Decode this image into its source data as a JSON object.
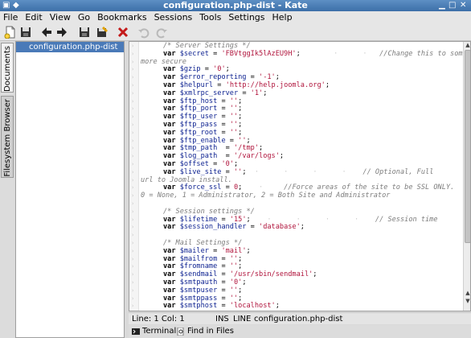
{
  "window": {
    "title": "configuration.php-dist - Kate"
  },
  "menu": [
    "File",
    "Edit",
    "View",
    "Go",
    "Bookmarks",
    "Sessions",
    "Tools",
    "Settings",
    "Help"
  ],
  "toolbar": {
    "icons": [
      "new-document-icon",
      "save-icon",
      "back-arrow-icon",
      "forward-arrow-icon",
      "save-as-icon",
      "save-all-icon",
      "close-icon",
      "undo-icon",
      "redo-icon"
    ]
  },
  "sidebar": {
    "tabs": [
      "Documents",
      "Filesystem Browser"
    ],
    "documents": [
      "configuration.php-dist"
    ]
  },
  "editor": {
    "lines": [
      [
        {
          "c": "cm",
          "t": "/* Server Settings */"
        }
      ],
      [
        {
          "c": "kw",
          "t": "var "
        },
        {
          "c": "var",
          "t": "$secret"
        },
        {
          "c": "",
          "t": " = "
        },
        {
          "c": "str",
          "t": "'FBVtggIk5lAzEU9H'"
        },
        {
          "c": "",
          "t": ";"
        },
        {
          "c": "dots",
          "t": "        ·      ·   "
        },
        {
          "c": "cm",
          "t": "//Change this to something"
        }
      ],
      [
        {
          "c": "cm",
          "t": "more secure"
        }
      ],
      [
        {
          "c": "kw",
          "t": "var "
        },
        {
          "c": "var",
          "t": "$gzip"
        },
        {
          "c": "",
          "t": " = "
        },
        {
          "c": "str",
          "t": "'0'"
        },
        {
          "c": "",
          "t": ";"
        }
      ],
      [
        {
          "c": "kw",
          "t": "var "
        },
        {
          "c": "var",
          "t": "$error_reporting"
        },
        {
          "c": "",
          "t": " = "
        },
        {
          "c": "str",
          "t": "'-1'"
        },
        {
          "c": "",
          "t": ";"
        }
      ],
      [
        {
          "c": "kw",
          "t": "var "
        },
        {
          "c": "var",
          "t": "$helpurl"
        },
        {
          "c": "",
          "t": " = "
        },
        {
          "c": "str",
          "t": "'http://help.joomla.org'"
        },
        {
          "c": "",
          "t": ";"
        }
      ],
      [
        {
          "c": "kw",
          "t": "var "
        },
        {
          "c": "var",
          "t": "$xmlrpc_server"
        },
        {
          "c": "",
          "t": " = "
        },
        {
          "c": "str",
          "t": "'1'"
        },
        {
          "c": "",
          "t": ";"
        }
      ],
      [
        {
          "c": "kw",
          "t": "var "
        },
        {
          "c": "var",
          "t": "$ftp_host"
        },
        {
          "c": "",
          "t": " = "
        },
        {
          "c": "str",
          "t": "''"
        },
        {
          "c": "",
          "t": ";"
        }
      ],
      [
        {
          "c": "kw",
          "t": "var "
        },
        {
          "c": "var",
          "t": "$ftp_port"
        },
        {
          "c": "",
          "t": " = "
        },
        {
          "c": "str",
          "t": "''"
        },
        {
          "c": "",
          "t": ";"
        }
      ],
      [
        {
          "c": "kw",
          "t": "var "
        },
        {
          "c": "var",
          "t": "$ftp_user"
        },
        {
          "c": "",
          "t": " = "
        },
        {
          "c": "str",
          "t": "''"
        },
        {
          "c": "",
          "t": ";"
        }
      ],
      [
        {
          "c": "kw",
          "t": "var "
        },
        {
          "c": "var",
          "t": "$ftp_pass"
        },
        {
          "c": "",
          "t": " = "
        },
        {
          "c": "str",
          "t": "''"
        },
        {
          "c": "",
          "t": ";"
        }
      ],
      [
        {
          "c": "kw",
          "t": "var "
        },
        {
          "c": "var",
          "t": "$ftp_root"
        },
        {
          "c": "",
          "t": " = "
        },
        {
          "c": "str",
          "t": "''"
        },
        {
          "c": "",
          "t": ";"
        }
      ],
      [
        {
          "c": "kw",
          "t": "var "
        },
        {
          "c": "var",
          "t": "$ftp_enable"
        },
        {
          "c": "",
          "t": " = "
        },
        {
          "c": "str",
          "t": "''"
        },
        {
          "c": "",
          "t": ";"
        }
      ],
      [
        {
          "c": "kw",
          "t": "var "
        },
        {
          "c": "var",
          "t": "$tmp_path"
        },
        {
          "c": "",
          "t": "  = "
        },
        {
          "c": "str",
          "t": "'/tmp'"
        },
        {
          "c": "",
          "t": ";"
        }
      ],
      [
        {
          "c": "kw",
          "t": "var "
        },
        {
          "c": "var",
          "t": "$log_path"
        },
        {
          "c": "",
          "t": "  = "
        },
        {
          "c": "str",
          "t": "'/var/logs'"
        },
        {
          "c": "",
          "t": ";"
        }
      ],
      [
        {
          "c": "kw",
          "t": "var "
        },
        {
          "c": "var",
          "t": "$offset"
        },
        {
          "c": "",
          "t": " = "
        },
        {
          "c": "str",
          "t": "'0'"
        },
        {
          "c": "",
          "t": ";"
        }
      ],
      [
        {
          "c": "kw",
          "t": "var "
        },
        {
          "c": "var",
          "t": "$live_site"
        },
        {
          "c": "",
          "t": " = "
        },
        {
          "c": "str",
          "t": "''"
        },
        {
          "c": "",
          "t": ";"
        },
        {
          "c": "dots",
          "t": "  ·      ·      ·      ·    "
        },
        {
          "c": "cm",
          "t": "// Optional, Full"
        }
      ],
      [
        {
          "c": "cm",
          "t": "url to Joomla install."
        }
      ],
      [
        {
          "c": "kw",
          "t": "var "
        },
        {
          "c": "var",
          "t": "$force_ssl"
        },
        {
          "c": "",
          "t": " = "
        },
        {
          "c": "num",
          "t": "0"
        },
        {
          "c": "",
          "t": ";"
        },
        {
          "c": "dots",
          "t": "    ·     "
        },
        {
          "c": "cm",
          "t": "//Force areas of the site to be SSL ONLY."
        }
      ],
      [
        {
          "c": "cm",
          "t": "0 = None, 1 = Administrator, 2 = Both Site and Administrator"
        }
      ],
      [
        {
          "c": "",
          "t": ""
        }
      ],
      [
        {
          "c": "cm",
          "t": "/* Session settings */"
        }
      ],
      [
        {
          "c": "kw",
          "t": "var "
        },
        {
          "c": "var",
          "t": "$lifetime"
        },
        {
          "c": "",
          "t": " = "
        },
        {
          "c": "str",
          "t": "'15'"
        },
        {
          "c": "",
          "t": ";"
        },
        {
          "c": "dots",
          "t": "    ·      ·      ·      ·    "
        },
        {
          "c": "cm",
          "t": "// Session time"
        }
      ],
      [
        {
          "c": "kw",
          "t": "var "
        },
        {
          "c": "var",
          "t": "$session_handler"
        },
        {
          "c": "",
          "t": " = "
        },
        {
          "c": "str",
          "t": "'database'"
        },
        {
          "c": "",
          "t": ";"
        }
      ],
      [
        {
          "c": "",
          "t": ""
        }
      ],
      [
        {
          "c": "cm",
          "t": "/* Mail Settings */"
        }
      ],
      [
        {
          "c": "kw",
          "t": "var "
        },
        {
          "c": "var",
          "t": "$mailer"
        },
        {
          "c": "",
          "t": " = "
        },
        {
          "c": "str",
          "t": "'mail'"
        },
        {
          "c": "",
          "t": ";"
        }
      ],
      [
        {
          "c": "kw",
          "t": "var "
        },
        {
          "c": "var",
          "t": "$mailfrom"
        },
        {
          "c": "",
          "t": " = "
        },
        {
          "c": "str",
          "t": "''"
        },
        {
          "c": "",
          "t": ";"
        }
      ],
      [
        {
          "c": "kw",
          "t": "var "
        },
        {
          "c": "var",
          "t": "$fromname"
        },
        {
          "c": "",
          "t": " = "
        },
        {
          "c": "str",
          "t": "''"
        },
        {
          "c": "",
          "t": ";"
        }
      ],
      [
        {
          "c": "kw",
          "t": "var "
        },
        {
          "c": "var",
          "t": "$sendmail"
        },
        {
          "c": "",
          "t": " = "
        },
        {
          "c": "str",
          "t": "'/usr/sbin/sendmail'"
        },
        {
          "c": "",
          "t": ";"
        }
      ],
      [
        {
          "c": "kw",
          "t": "var "
        },
        {
          "c": "var",
          "t": "$smtpauth"
        },
        {
          "c": "",
          "t": " = "
        },
        {
          "c": "str",
          "t": "'0'"
        },
        {
          "c": "",
          "t": ";"
        }
      ],
      [
        {
          "c": "kw",
          "t": "var "
        },
        {
          "c": "var",
          "t": "$smtpuser"
        },
        {
          "c": "",
          "t": " = "
        },
        {
          "c": "str",
          "t": "''"
        },
        {
          "c": "",
          "t": ";"
        }
      ],
      [
        {
          "c": "kw",
          "t": "var "
        },
        {
          "c": "var",
          "t": "$smtppass"
        },
        {
          "c": "",
          "t": " = "
        },
        {
          "c": "str",
          "t": "''"
        },
        {
          "c": "",
          "t": ";"
        }
      ],
      [
        {
          "c": "kw",
          "t": "var "
        },
        {
          "c": "var",
          "t": "$smtphost"
        },
        {
          "c": "",
          "t": " = "
        },
        {
          "c": "str",
          "t": "'localhost'"
        },
        {
          "c": "",
          "t": ";"
        }
      ]
    ],
    "indented": [
      false,
      true,
      false,
      true,
      true,
      true,
      true,
      true,
      true,
      true,
      true,
      true,
      true,
      true,
      true,
      true,
      true,
      false,
      true,
      false,
      false,
      false,
      true,
      true,
      false,
      false,
      true,
      true,
      true,
      true,
      true,
      true,
      true,
      true
    ]
  },
  "status": {
    "position": "Line: 1 Col: 1",
    "mode": "INS",
    "line_mode": "LINE",
    "filename": "configuration.php-dist"
  },
  "bottom_tabs": [
    "Terminal",
    "Find in Files"
  ],
  "colors": {
    "titlebar": "#3c6fa8",
    "selection": "#4a7ab8",
    "string": "#b0143c",
    "variable": "#0a1f8f",
    "comment": "#7d7d7d"
  }
}
